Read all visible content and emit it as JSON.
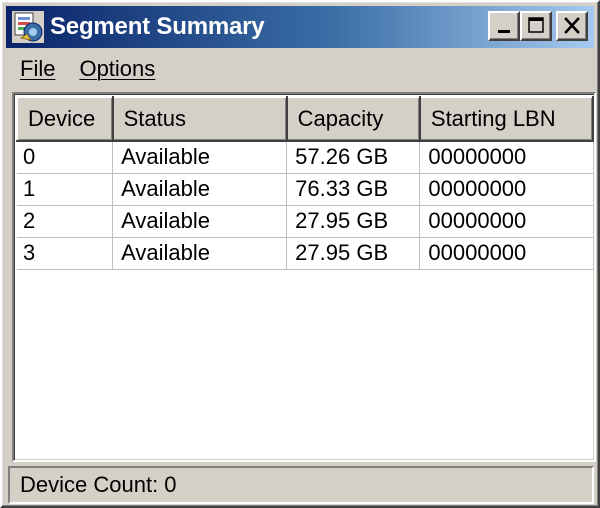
{
  "window": {
    "title": "Segment Summary",
    "icon": "app-icon",
    "caption_buttons": [
      "minimize-icon",
      "maximize-icon",
      "close-icon"
    ]
  },
  "menu": {
    "items": [
      {
        "label": "File",
        "mnemonic": "F"
      },
      {
        "label": "Options",
        "mnemonic": "O"
      }
    ]
  },
  "table": {
    "columns": [
      "Device",
      "Status",
      "Capacity",
      "Starting LBN"
    ],
    "rows": [
      [
        "0",
        "Available",
        "57.26 GB",
        "00000000"
      ],
      [
        "1",
        "Available",
        "76.33 GB",
        "00000000"
      ],
      [
        "2",
        "Available",
        "27.95 GB",
        "00000000"
      ],
      [
        "3",
        "Available",
        "27.95 GB",
        "00000000"
      ]
    ]
  },
  "statusbar": {
    "text": "Device Count: 0"
  },
  "colors": {
    "title_gradient_start": "#0a246a",
    "title_gradient_end": "#a6caf0",
    "face": "#d4d0c8",
    "title_text": "#ffffff"
  }
}
